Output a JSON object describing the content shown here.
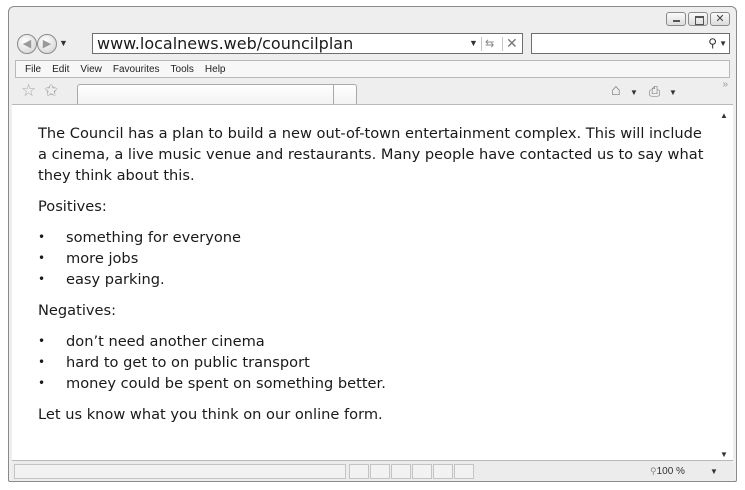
{
  "browser": {
    "address": "www.localnews.web/councilplan",
    "menu": [
      "File",
      "Edit",
      "View",
      "Favourites",
      "Tools",
      "Help"
    ],
    "zoom_label": "100 %",
    "icons": {
      "back": "back-arrow-icon",
      "forward": "forward-arrow-icon",
      "refresh": "refresh-icon",
      "stop": "stop-icon",
      "search": "search-icon",
      "favourites": "star-icon",
      "add_favourite": "add-favourite-icon",
      "home": "home-icon",
      "print": "print-icon"
    }
  },
  "page": {
    "intro": "The Council has a plan to build a new out-of-town entertainment complex. This will include a cinema, a live music venue and restaurants. Many people have contacted us to say what they think about this.",
    "positives_heading": "Positives:",
    "positives": [
      "something for everyone",
      "more jobs",
      "easy parking."
    ],
    "negatives_heading": "Negatives:",
    "negatives": [
      "don’t need another cinema",
      "hard to get to on public transport",
      "money could be spent on something better."
    ],
    "closing": "Let us know what you think on our online form."
  }
}
